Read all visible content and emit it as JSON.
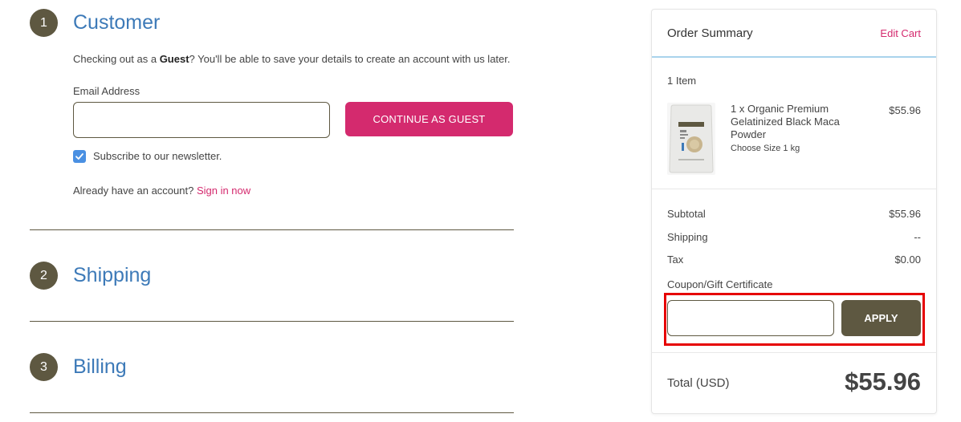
{
  "steps": [
    {
      "number": "1",
      "title": "Customer"
    },
    {
      "number": "2",
      "title": "Shipping"
    },
    {
      "number": "3",
      "title": "Billing"
    }
  ],
  "customer": {
    "guest_prefix": "Checking out as a ",
    "guest_bold": "Guest",
    "guest_suffix": "? You'll be able to save your details to create an account with us later.",
    "email_label": "Email Address",
    "email_value": "",
    "continue_button": "CONTINUE AS GUEST",
    "newsletter_checked": true,
    "newsletter_label": "Subscribe to our newsletter.",
    "signin_prompt": "Already have an account? ",
    "signin_link": "Sign in now"
  },
  "summary": {
    "title": "Order Summary",
    "edit_cart": "Edit Cart",
    "item_count": "1 Item",
    "item": {
      "name": "1 x Organic Premium Gelatinized Black Maca Powder",
      "option": "Choose Size 1 kg",
      "price": "$55.96"
    },
    "rows": [
      {
        "label": "Subtotal",
        "value": "$55.96"
      },
      {
        "label": "Shipping",
        "value": "--"
      },
      {
        "label": "Tax",
        "value": "$0.00"
      }
    ],
    "coupon_label": "Coupon/Gift Certificate",
    "coupon_value": "",
    "apply_button": "APPLY",
    "total_label": "Total (USD)",
    "total_value": "$55.96"
  },
  "colors": {
    "accent_pink": "#d42a6e",
    "step_circle": "#5e5841",
    "step_title": "#3d7ab8",
    "highlight_box": "#e60000"
  },
  "icons": {
    "checkbox": "checkmark-icon",
    "product": "product-pouch-image"
  }
}
